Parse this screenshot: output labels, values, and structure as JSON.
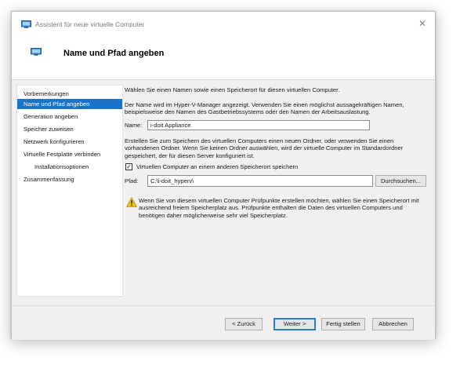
{
  "window": {
    "title": "Assistent für neue virtuelle Computer",
    "close_glyph": "✕",
    "icon": "vm-icon"
  },
  "header": {
    "title": "Name und Pfad angeben",
    "icon": "vm-icon"
  },
  "nav": {
    "items": [
      {
        "label": "Vorbemerkungen",
        "active": false,
        "sub": false
      },
      {
        "label": "Name und Pfad angeben",
        "active": true,
        "sub": false
      },
      {
        "label": "Generation angeben",
        "active": false,
        "sub": false
      },
      {
        "label": "Speicher zuweisen",
        "active": false,
        "sub": false
      },
      {
        "label": "Netzwerk konfigurieren",
        "active": false,
        "sub": false
      },
      {
        "label": "Virtuelle Festplatte verbinden",
        "active": false,
        "sub": false
      },
      {
        "label": "Installationsoptionen",
        "active": false,
        "sub": true
      },
      {
        "label": "Zusammenfassung",
        "active": false,
        "sub": false
      }
    ]
  },
  "content": {
    "intro": "Wählen Sie einen Namen sowie einen Speicherort für diesen virtuellen Computer.",
    "name_hint": "Der Name wird im Hyper-V-Manager angezeigt. Verwenden Sie einen möglichst aussagekräftigen Namen, beispielsweise den Namen des Gastbetriebssystems oder den Namen der Arbeitsauslastung.",
    "name_label": "Name:",
    "name_value": "i-doit Appliance",
    "folder_hint": "Erstellen Sie zum Speichern des virtuellen Computers einen neuen Ordner, oder verwenden Sie einen vorhandenen Ordner. Wenn Sie keinen Ordner auswählen, wird der virtuelle Computer im Standardordner gespeichert, der für diesen Server konfiguriert ist.",
    "store_elsewhere_label": "Virtuellen Computer an einem anderen Speicherort speichern",
    "store_elsewhere_checked": true,
    "path_label": "Pfad:",
    "path_value": "C:\\i-doit_hyperv\\",
    "browse_label": "Durchsuchen...",
    "warning_text": "Wenn Sie von diesem virtuellen Computer Prüfpunkte erstellen möchten, wählen Sie einen Speicherort mit ausreichend freiem Speicherplatz aus. Prüfpunkte enthalten die Daten des virtuellen Computers und benötigen daher möglicherweise sehr viel Speicherplatz."
  },
  "footer": {
    "back_label": "< Zurück",
    "next_label": "Weiter >",
    "finish_label": "Fertig stellen",
    "cancel_label": "Abbrechen"
  },
  "colors": {
    "accent": "#1a73c9",
    "background": "#f0f0f0",
    "warning": "#f2c200"
  }
}
